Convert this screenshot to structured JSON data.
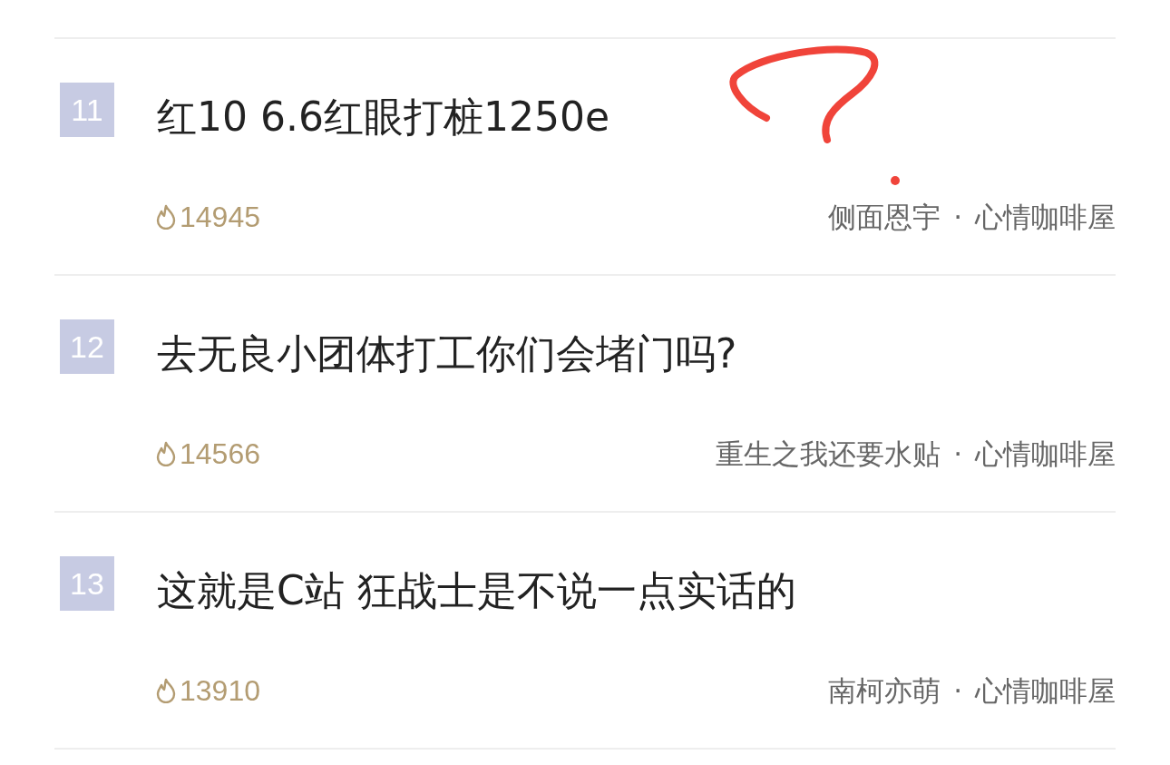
{
  "posts": [
    {
      "rank": "11",
      "title": "红10 6.6红眼打桩1250e",
      "heat": "14945",
      "author": "侧面恩宇",
      "board": "心情咖啡屋"
    },
    {
      "rank": "12",
      "title": "去无良小团体打工你们会堵门吗?",
      "heat": "14566",
      "author": "重生之我还要水贴",
      "board": "心情咖啡屋"
    },
    {
      "rank": "13",
      "title": "这就是C站 狂战士是不说一点实话的",
      "heat": "13910",
      "author": "南柯亦萌",
      "board": "心情咖啡屋"
    }
  ],
  "separator": "·"
}
